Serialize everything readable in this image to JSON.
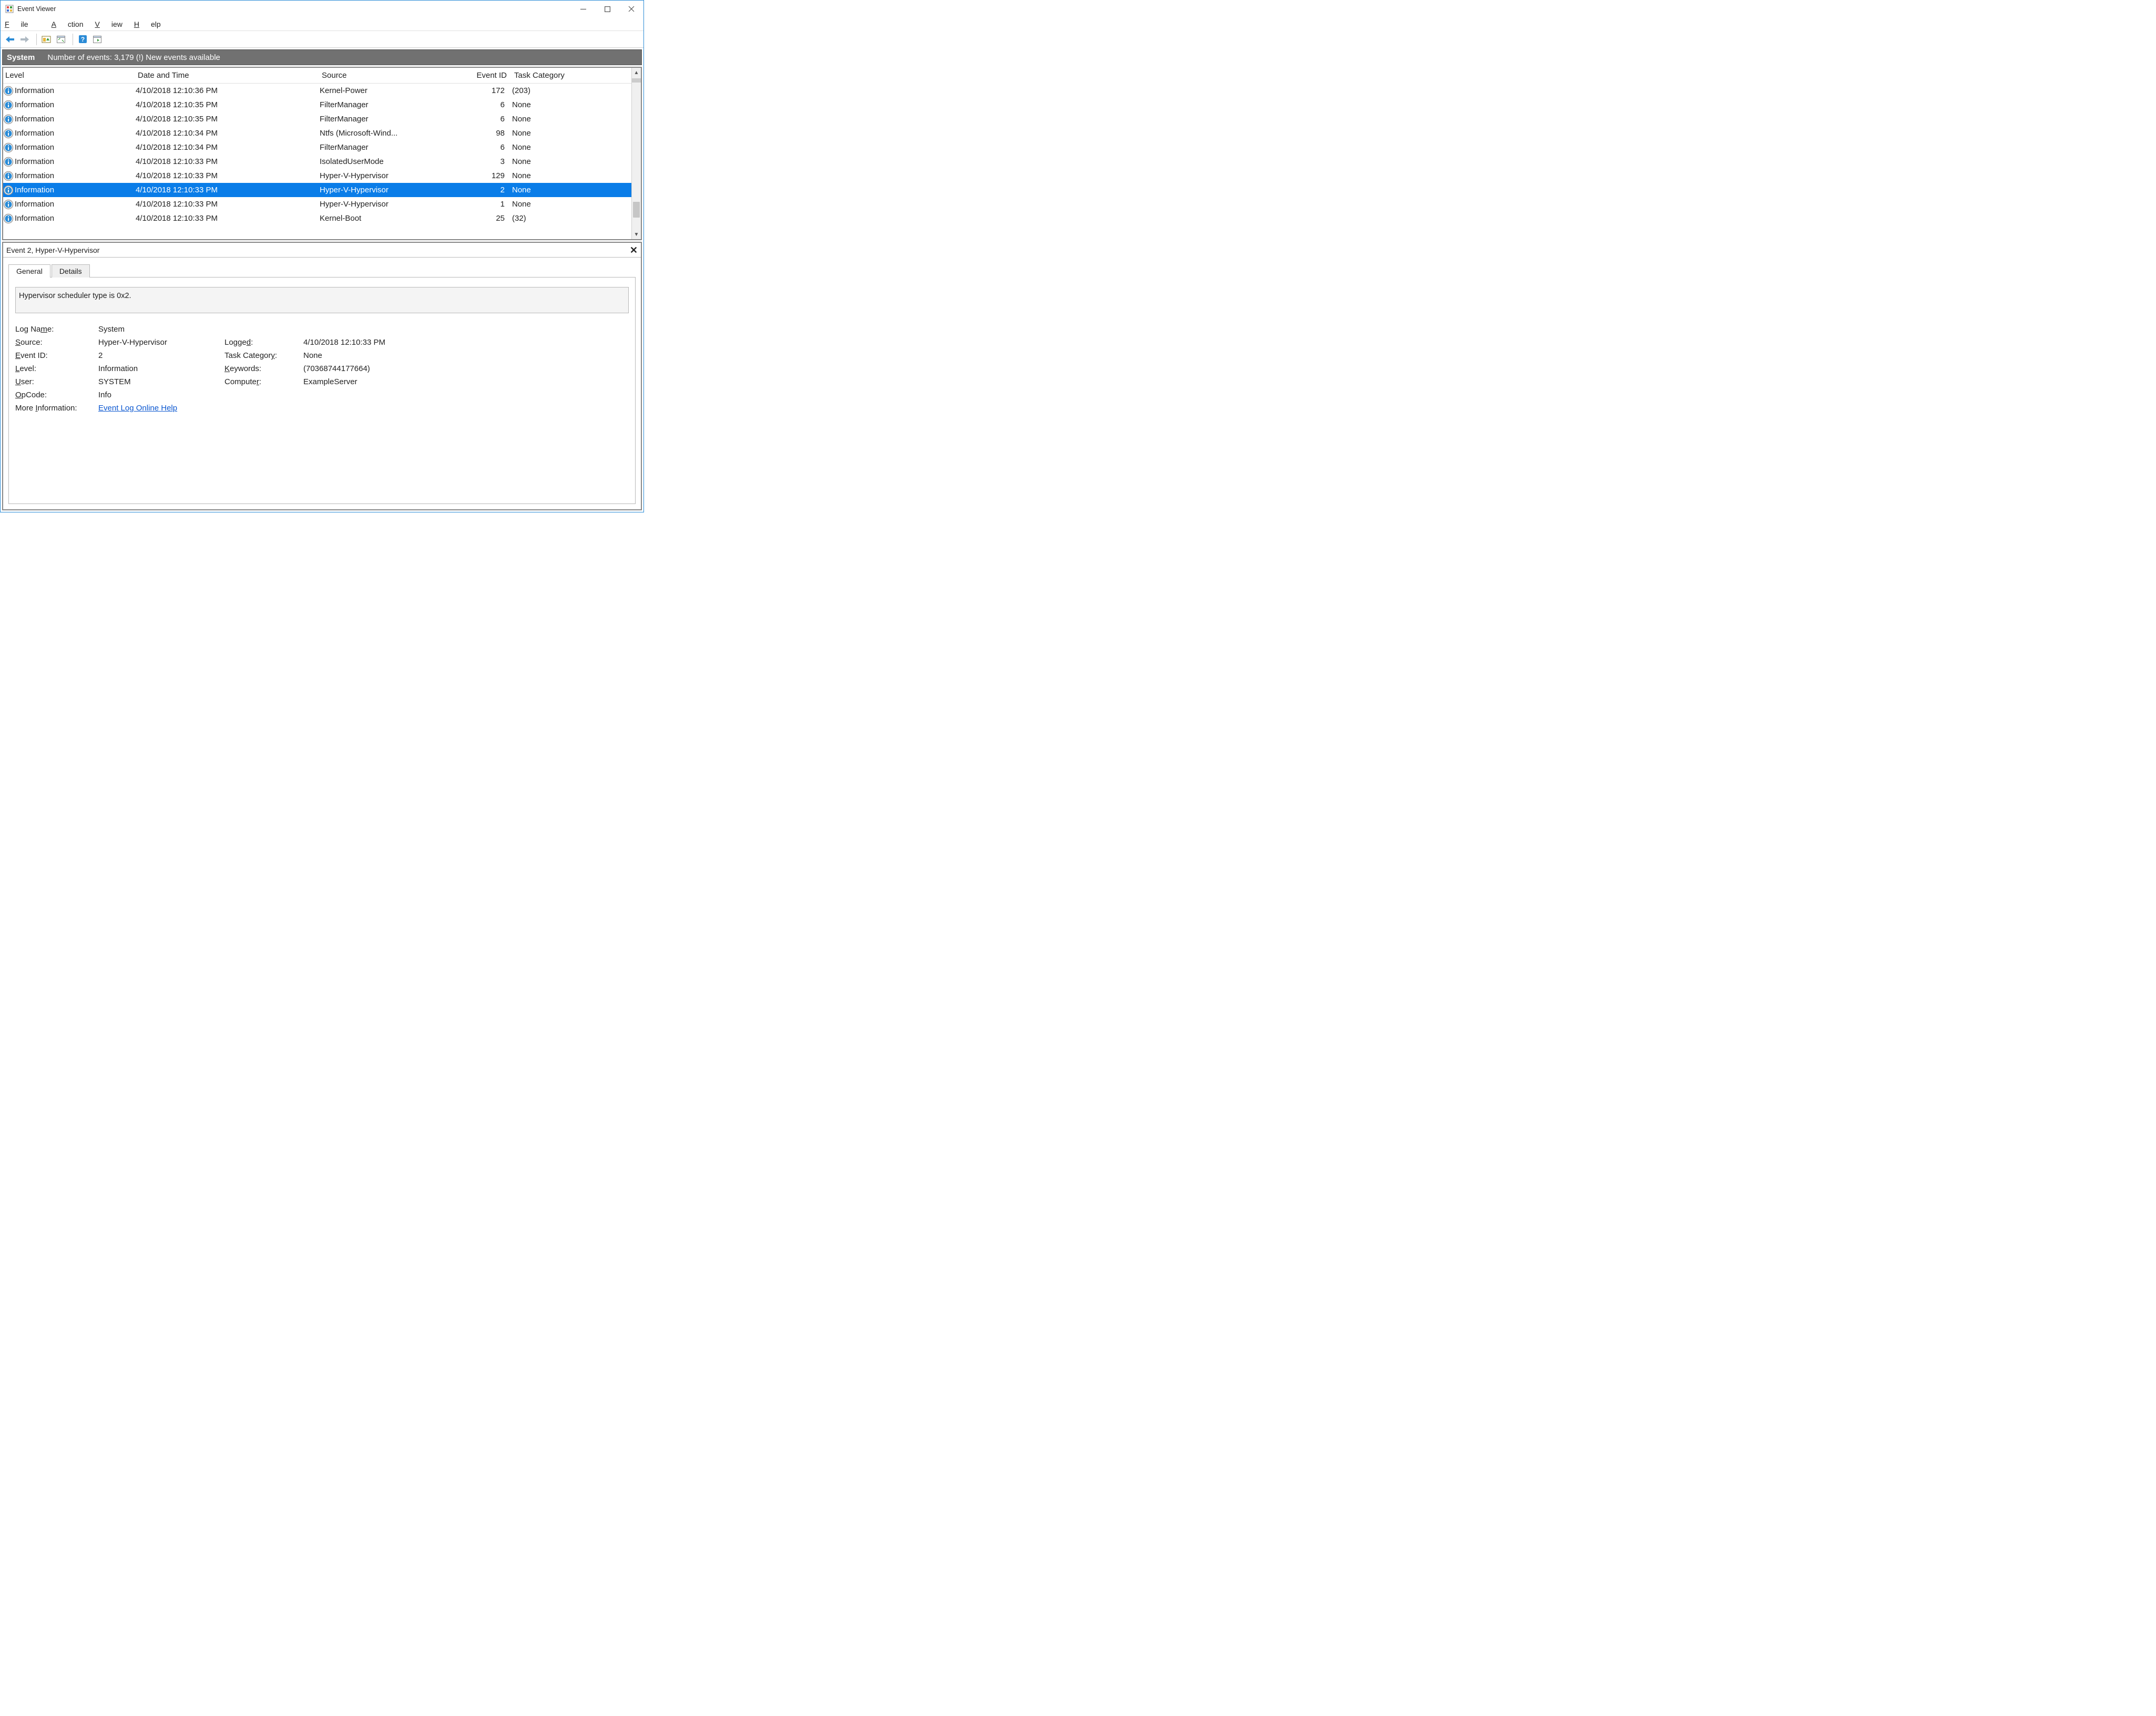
{
  "window": {
    "title": "Event Viewer"
  },
  "menu": {
    "file": "File",
    "action": "Action",
    "view": "View",
    "help": "Help"
  },
  "band": {
    "system": "System",
    "events": "Number of events: 3,179 (!) New events available"
  },
  "table": {
    "headers": {
      "level": "Level",
      "date": "Date and Time",
      "source": "Source",
      "eventid": "Event ID",
      "task": "Task Category"
    },
    "rows": [
      {
        "level": "Information",
        "date": "4/10/2018 12:10:36 PM",
        "source": "Kernel-Power",
        "eventid": "172",
        "task": "(203)",
        "sel": false
      },
      {
        "level": "Information",
        "date": "4/10/2018 12:10:35 PM",
        "source": "FilterManager",
        "eventid": "6",
        "task": "None",
        "sel": false
      },
      {
        "level": "Information",
        "date": "4/10/2018 12:10:35 PM",
        "source": "FilterManager",
        "eventid": "6",
        "task": "None",
        "sel": false
      },
      {
        "level": "Information",
        "date": "4/10/2018 12:10:34 PM",
        "source": "Ntfs (Microsoft-Wind...",
        "eventid": "98",
        "task": "None",
        "sel": false
      },
      {
        "level": "Information",
        "date": "4/10/2018 12:10:34 PM",
        "source": "FilterManager",
        "eventid": "6",
        "task": "None",
        "sel": false
      },
      {
        "level": "Information",
        "date": "4/10/2018 12:10:33 PM",
        "source": "IsolatedUserMode",
        "eventid": "3",
        "task": "None",
        "sel": false
      },
      {
        "level": "Information",
        "date": "4/10/2018 12:10:33 PM",
        "source": "Hyper-V-Hypervisor",
        "eventid": "129",
        "task": "None",
        "sel": false
      },
      {
        "level": "Information",
        "date": "4/10/2018 12:10:33 PM",
        "source": "Hyper-V-Hypervisor",
        "eventid": "2",
        "task": "None",
        "sel": true
      },
      {
        "level": "Information",
        "date": "4/10/2018 12:10:33 PM",
        "source": "Hyper-V-Hypervisor",
        "eventid": "1",
        "task": "None",
        "sel": false
      },
      {
        "level": "Information",
        "date": "4/10/2018 12:10:33 PM",
        "source": "Kernel-Boot",
        "eventid": "25",
        "task": "(32)",
        "sel": false
      }
    ]
  },
  "detail": {
    "title": "Event 2, Hyper-V-Hypervisor",
    "tabs": {
      "general": "General",
      "details": "Details"
    },
    "message": "Hypervisor scheduler type is 0x2.",
    "fields": {
      "logNameLbl": "Log Name:",
      "logName": "System",
      "sourceLbl": "Source:",
      "source": "Hyper-V-Hypervisor",
      "loggedLbl": "Logged:",
      "logged": "4/10/2018 12:10:33 PM",
      "eventIdLbl": "Event ID:",
      "eventId": "2",
      "taskCatLbl": "Task Category:",
      "taskCat": "None",
      "levelLbl": "Level:",
      "level": "Information",
      "keywordsLbl": "Keywords:",
      "keywords": "(70368744177664)",
      "userLbl": "User:",
      "user": "SYSTEM",
      "computerLbl": "Computer:",
      "computer": "ExampleServer",
      "opcodeLbl": "OpCode:",
      "opcode": "Info",
      "moreInfoLbl": "More Information:",
      "moreInfoLink": "Event Log Online Help"
    }
  }
}
